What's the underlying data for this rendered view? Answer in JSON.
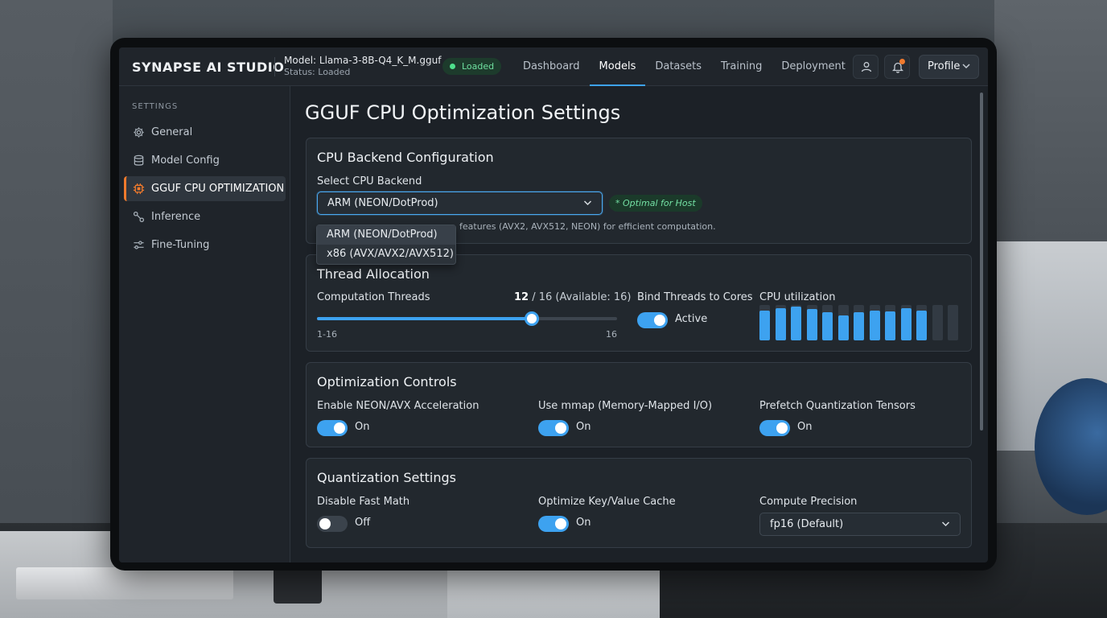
{
  "topbar": {
    "brand": "SYNAPSE AI STUDIO",
    "model_name": "Model: Llama-3-8B-Q4_K_M.gguf",
    "model_status": "Status: Loaded",
    "loaded_badge": "Loaded",
    "nav": [
      "Dashboard",
      "Models",
      "Datasets",
      "Training",
      "Deployment"
    ],
    "active_nav": "Models",
    "profile_label": "Profile"
  },
  "sidebar": {
    "heading": "SETTINGS",
    "items": [
      {
        "label": "General",
        "icon": "gear-icon"
      },
      {
        "label": "Model Config",
        "icon": "database-icon"
      },
      {
        "label": "GGUF CPU OPTIMIZATION",
        "icon": "cpu-chip-icon"
      },
      {
        "label": "Inference",
        "icon": "inference-icon"
      },
      {
        "label": "Fine-Tuning",
        "icon": "sliders-icon"
      }
    ],
    "active_item": "GGUF CPU OPTIMIZATION"
  },
  "page": {
    "title": "GGUF CPU Optimization Settings"
  },
  "backend": {
    "title": "CPU Backend Configuration",
    "select_label": "Select CPU Backend",
    "selected": "ARM (NEON/DotProd)",
    "optimal_badge": "* Optimal for Host",
    "helper_text": "features (AVX2, AVX512, NEON) for efficient computation.",
    "options": [
      "ARM (NEON/DotProd)",
      "x86 (AVX/AVX2/AVX512)"
    ]
  },
  "threads": {
    "title": "Thread Allocation",
    "label": "Computation Threads",
    "current": "12",
    "rest": " / 16 (Available: 16)",
    "value": 12,
    "max": 16,
    "range_label": "1-16",
    "max_label": "16",
    "bind_label": "Bind Threads to Cores",
    "bind_state": "Active",
    "cpu_label": "CPU utilization",
    "cpu_utilization": [
      0.85,
      0.9,
      0.95,
      0.88,
      0.8,
      0.7,
      0.8,
      0.85,
      0.82,
      0.9,
      0.85,
      0.0,
      0.0
    ]
  },
  "optimization": {
    "title": "Optimization Controls",
    "controls": [
      {
        "label": "Enable NEON/AVX Acceleration",
        "state": "On"
      },
      {
        "label": "Use mmap (Memory-Mapped I/O)",
        "state": "On"
      },
      {
        "label": "Prefetch Quantization Tensors",
        "state": "On"
      }
    ]
  },
  "quantization": {
    "title": "Quantization Settings",
    "fast_math_label": "Disable Fast Math",
    "fast_math_state": "Off",
    "kv_label": "Optimize Key/Value Cache",
    "kv_state": "On",
    "precision_label": "Compute Precision",
    "precision_value": "fp16 (Default)"
  },
  "colors": {
    "accent": "#3da2f0",
    "active_marker": "#f07a2d",
    "success": "#4ee08c"
  }
}
